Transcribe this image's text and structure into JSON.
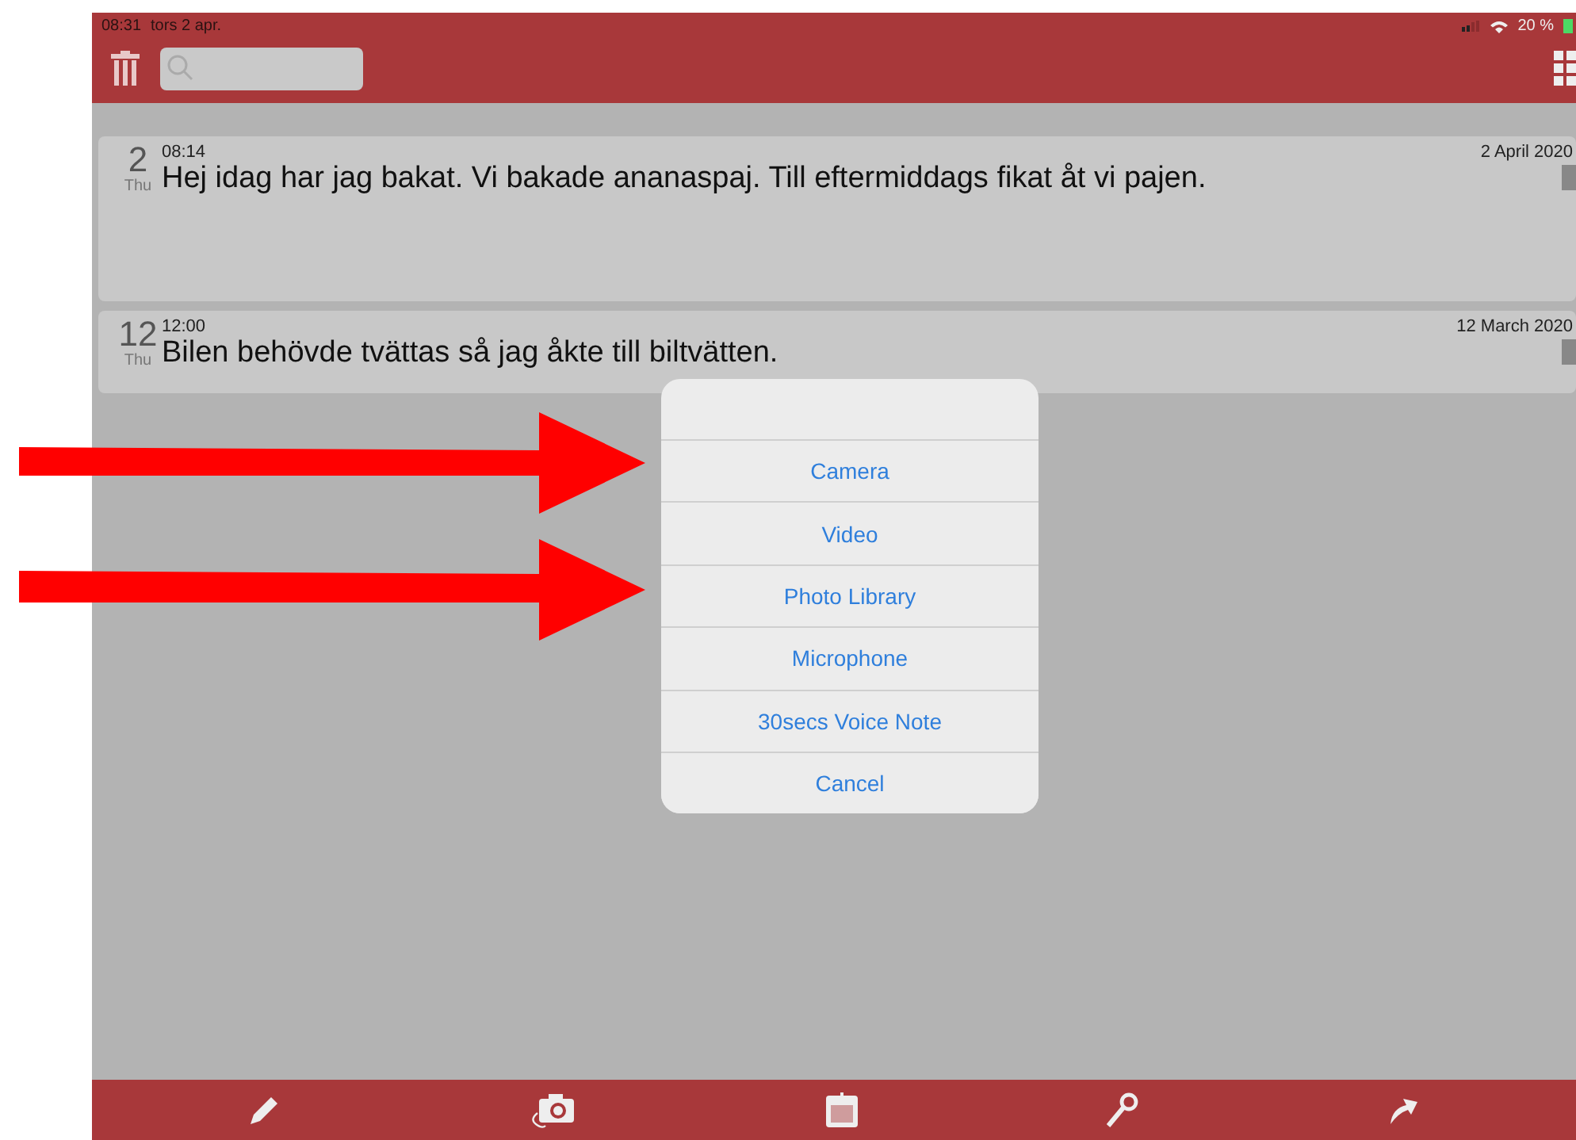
{
  "status_bar": {
    "time": "08:31",
    "date": "tors 2 apr.",
    "battery": "20 %"
  },
  "entries": [
    {
      "day": "2",
      "weekday": "Thu",
      "time": "08:14",
      "text": "Hej idag har jag bakat. Vi bakade ananaspaj. Till eftermiddags fikat åt vi pajen.",
      "date": "2 April 2020",
      "tall": true
    },
    {
      "day": "12",
      "weekday": "Thu",
      "time": "12:00",
      "text": "Bilen behövde tvättas så jag åkte till biltvätten.",
      "date": "12 March 2020",
      "tall": false
    }
  ],
  "action_sheet": {
    "items": [
      "Camera",
      "Video",
      "Photo Library",
      "Microphone",
      "30secs Voice Note",
      "Cancel"
    ]
  }
}
